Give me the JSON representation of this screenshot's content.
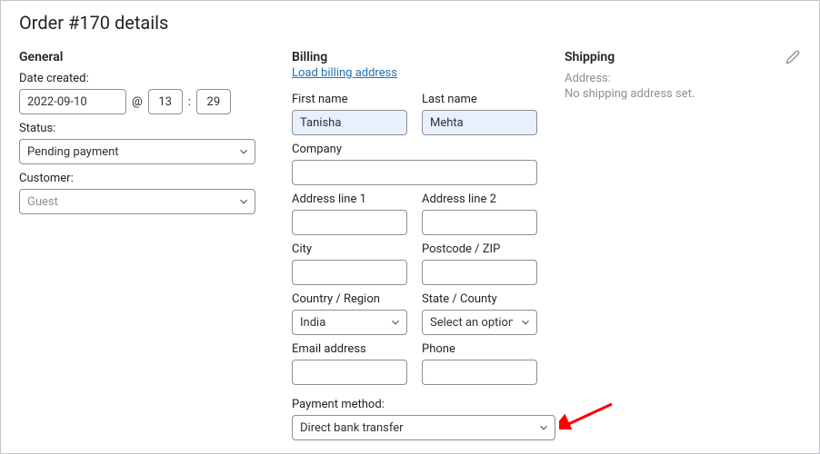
{
  "title": "Order #170 details",
  "general": {
    "heading": "General",
    "date_label": "Date created:",
    "date_value": "2022-09-10",
    "at_symbol": "@",
    "hour_value": "13",
    "sep": ":",
    "minute_value": "29",
    "status_label": "Status:",
    "status_value": "Pending payment",
    "customer_label": "Customer:",
    "customer_value": "Guest"
  },
  "billing": {
    "heading": "Billing",
    "load_link": "Load billing address",
    "first_name_label": "First name",
    "first_name_value": "Tanisha",
    "last_name_label": "Last name",
    "last_name_value": "Mehta",
    "company_label": "Company",
    "company_value": "",
    "addr1_label": "Address line 1",
    "addr1_value": "",
    "addr2_label": "Address line 2",
    "addr2_value": "",
    "city_label": "City",
    "city_value": "",
    "postcode_label": "Postcode / ZIP",
    "postcode_value": "",
    "country_label": "Country / Region",
    "country_value": "India",
    "state_label": "State / County",
    "state_value": "Select an option…",
    "email_label": "Email address",
    "email_value": "",
    "phone_label": "Phone",
    "phone_value": "",
    "payment_label": "Payment method:",
    "payment_value": "Direct bank transfer"
  },
  "shipping": {
    "heading": "Shipping",
    "address_label": "Address:",
    "no_address": "No shipping address set."
  }
}
